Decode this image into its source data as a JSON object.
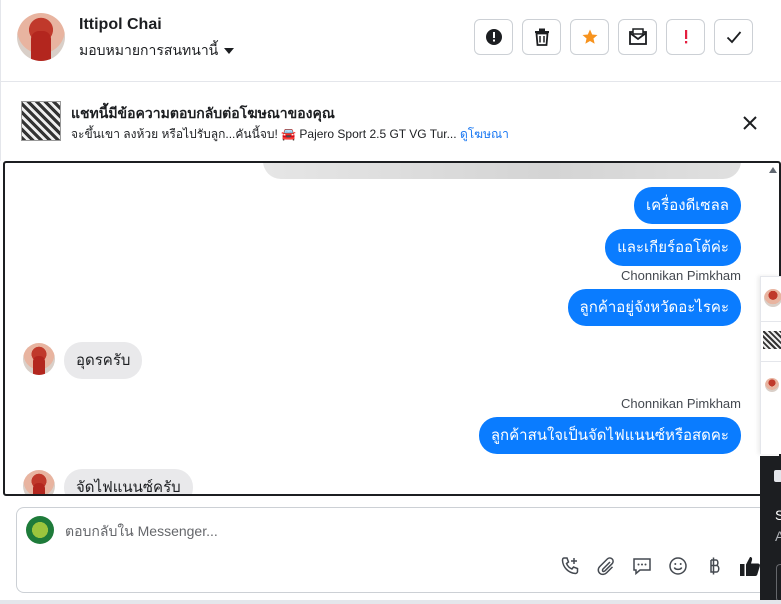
{
  "header": {
    "contact_name": "Ittipol Chai",
    "assign_label": "มอบหมายการสนทนานี้",
    "actions": [
      {
        "name": "spam-button",
        "icon": "alert-circle-icon"
      },
      {
        "name": "delete-button",
        "icon": "trash-icon"
      },
      {
        "name": "star-button",
        "icon": "star-icon",
        "color": "#f7931e"
      },
      {
        "name": "mark-unread-button",
        "icon": "envelope-icon"
      },
      {
        "name": "follow-up-button",
        "icon": "exclamation-icon",
        "color": "#e41e3f"
      },
      {
        "name": "mark-done-button",
        "icon": "check-icon"
      }
    ]
  },
  "ad_banner": {
    "title": "แชทนี้มีข้อความตอบกลับต่อโฆษณาของคุณ",
    "subtitle": "จะขึ้นเขา ลงห้วย หรือไปรับลูก...คันนี้จบ! 🚘 Pajero Sport 2.5 GT VG Tur...",
    "link": "ดูโฆษณา"
  },
  "messages": [
    {
      "type": "out",
      "text": "เครื่องดีเซลล"
    },
    {
      "type": "out",
      "text": "และเกียร์ออโต้ค่ะ"
    },
    {
      "type": "sender",
      "text": "Chonnikan Pimkham"
    },
    {
      "type": "out",
      "text": "ลูกค้าอยู่จังหวัดอะไรคะ"
    },
    {
      "type": "in",
      "text": "อุดรครับ"
    },
    {
      "type": "sender",
      "text": "Chonnikan Pimkham"
    },
    {
      "type": "out",
      "text": "ลูกค้าสนใจเป็นจัดไฟแนนซ์หรือสดคะ"
    },
    {
      "type": "in",
      "text": "จัดไฟแนนซ์ครับ"
    }
  ],
  "composer": {
    "placeholder": "ตอบกลับใน Messenger..."
  },
  "tools": [
    "phone-plus-icon",
    "paperclip-icon",
    "chat-icon",
    "emoji-icon",
    "baht-icon",
    "thumbs-up-icon"
  ],
  "colors": {
    "outgoing_bubble": "#0a7cff",
    "incoming_bubble": "#e9e9eb",
    "link": "#1877f2"
  },
  "side_panel": {
    "text_1": "S",
    "text_2": "A"
  }
}
